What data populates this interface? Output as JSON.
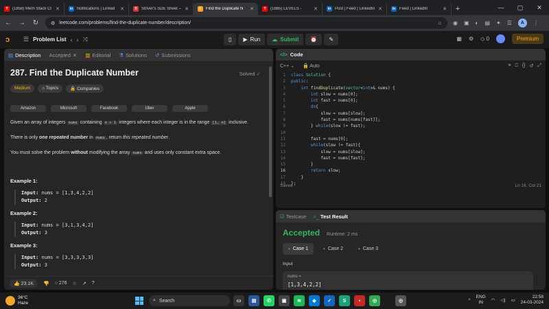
{
  "browser": {
    "tabs": [
      {
        "title": "(1858) Mern Stack Cl",
        "fav": "Y",
        "color": "#ff0000"
      },
      {
        "title": "Notifications | Linked",
        "fav": "in",
        "color": "#0a66c2"
      },
      {
        "title": "Striver's SDE Sheet –",
        "fav": "S",
        "color": "#e03131"
      },
      {
        "title": "Find the Duplicate N",
        "fav": "L",
        "color": "#ffa116",
        "active": true
      },
      {
        "title": "(1865) LEVELS -",
        "fav": "Y",
        "color": "#ff0000"
      },
      {
        "title": "Post | Feed | LinkedIn",
        "fav": "in",
        "color": "#0a66c2"
      },
      {
        "title": "Feed | LinkedIn",
        "fav": "in",
        "color": "#0a66c2"
      }
    ],
    "url": "leetcode.com/problems/find-the-duplicate-number/description/",
    "profile_letter": "A"
  },
  "header": {
    "problem_list": "Problem List",
    "run": "Run",
    "submit": "Submit",
    "coins": "0",
    "premium": "Premium"
  },
  "left": {
    "tabs": [
      "Description",
      "Accepted",
      "Editorial",
      "Solutions",
      "Submissions"
    ],
    "title": "287. Find the Duplicate Number",
    "solved": "Solved",
    "difficulty": "Medium",
    "topics": "Topics",
    "companies_label": "Companies",
    "companies": [
      "Amazon",
      "Microsoft",
      "Facebook",
      "Uber",
      "Apple"
    ],
    "p1_a": "Given an array of integers ",
    "p1_code1": "nums",
    "p1_b": " containing ",
    "p1_code2": "n + 1",
    "p1_c": " integers where each integer is in the range ",
    "p1_code3": "[1, n]",
    "p1_d": " inclusive.",
    "p2_a": "There is only ",
    "p2_bold": "one repeated number",
    "p2_b": " in ",
    "p2_code": "nums",
    "p2_c": ", return ",
    "p2_em": "this repeated number",
    "p2_d": ".",
    "p3_a": "You must solve the problem ",
    "p3_bold": "without",
    "p3_b": " modifying the array ",
    "p3_code": "nums",
    "p3_c": " and uses only constant extra space.",
    "examples": [
      {
        "h": "Example 1:",
        "input": "nums = [1,3,4,2,2]",
        "output": "2"
      },
      {
        "h": "Example 2:",
        "input": "nums = [3,1,3,4,2]",
        "output": "3"
      },
      {
        "h": "Example 3:",
        "input": "nums = [3,3,3,3,3]",
        "output": "3"
      }
    ],
    "input_label": "Input:",
    "output_label": "Output:",
    "likes": "23.1K",
    "comments": "276"
  },
  "code": {
    "title": "Code",
    "lang": "C++",
    "mode": "Auto",
    "saved": "Saved",
    "position": "Ln 16, Col 21"
  },
  "test": {
    "tab1": "Testcase",
    "tab2": "Test Result",
    "status": "Accepted",
    "runtime": "Runtime: 2 ms",
    "cases": [
      "Case 1",
      "Case 2",
      "Case 3"
    ],
    "input_label": "Input",
    "var": "nums =",
    "value": "[1,3,4,2,2]"
  },
  "taskbar": {
    "temp": "36°C",
    "weather": "Haze",
    "search": "Search",
    "lang1": "ENG",
    "lang2": "IN",
    "time": "22:58",
    "date": "24-03-2024"
  }
}
